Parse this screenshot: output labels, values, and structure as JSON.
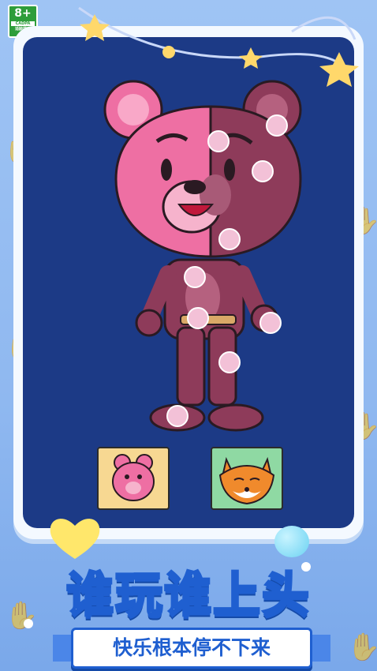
{
  "rating_badge": {
    "age": "8+",
    "code": "CADPA",
    "note": "适龄提示"
  },
  "game": {
    "title": "谁玩谁上头",
    "subtitle": "快乐根本停不下来"
  },
  "character_cards": [
    {
      "name": "pink-bear",
      "bg": "#f7d892"
    },
    {
      "name": "fox",
      "bg": "#8fd9a3"
    }
  ],
  "colors": {
    "board": "#1c3a86",
    "frame": "#f4f9ff",
    "bear_pink": "#ee6fa3",
    "bear_dark": "#8e3b5a",
    "title_stroke": "#1f5fd0"
  }
}
